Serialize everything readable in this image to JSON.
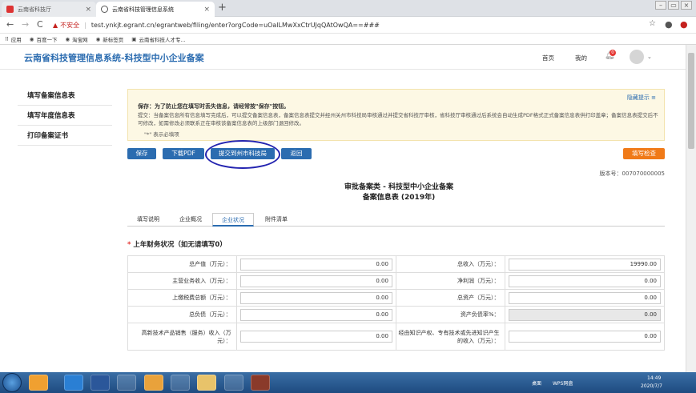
{
  "browser": {
    "tabs": [
      {
        "label": "云南省科技厅",
        "active": false,
        "color": "#d33"
      },
      {
        "label": "云南省科技管理信息系统",
        "active": true,
        "color": "#333"
      }
    ],
    "url_warning": "不安全",
    "url": "test.ynkjt.egrant.cn/egrantweb/filing/enter?orgCode=uOalLMwXxCtrUJqQAtOwQA==###",
    "bookmarks": [
      "应用",
      "百度一下",
      "淘宝网",
      "新标签页",
      "云南省科技人才专..."
    ]
  },
  "app": {
    "title": "云南省科技管理信息系统-科技型中小企业备案",
    "nav_home": "首页",
    "nav_mine": "我的",
    "notif_count": "0"
  },
  "sidebar": {
    "items": [
      "填写备案信息表",
      "填写年度信息表",
      "打印备案证书"
    ]
  },
  "notice": {
    "hide_label": "隐藏提示 ≡",
    "line1": "保存：为了防止您在填写时丢失信息，请经常按\"保存\"按钮。",
    "line2": "提交：当备案信息所有信息填写完成后，可以提交备案信息表，备案信息表提交并经州关州市科技局审核通过并提交省科技厅审核，省科技厅审核通过后系统会自动生成PDF格式正式备案信息表供打印盖章；备案信息表提交后不可修改，如需修改必须联系正在审核该备案信息表的上级部门退回修改。",
    "line3": "\"*\" 表示必填项"
  },
  "actions": {
    "save": "保存",
    "download": "下载PDF",
    "submit": "提交到州市科技局",
    "back": "返回",
    "check": "填写检查"
  },
  "version": "版本号：007070000005",
  "form": {
    "title1": "审批备案类 - 科技型中小企业备案",
    "title2": "备案信息表 (2019年)",
    "tabs": [
      "填写说明",
      "企业概况",
      "企业状况",
      "附件清单"
    ],
    "active_tab": 2,
    "section_title": "上年财务状况（如无请填写0）",
    "section_req": "*"
  },
  "finance": {
    "rows": [
      {
        "l1": "总产值（万元）：",
        "v1": "0.00",
        "l2": "总收入（万元）：",
        "v2": "19990.00",
        "ro2": false
      },
      {
        "l1": "主营业务收入（万元）：",
        "v1": "0.00",
        "l2": "净利润（万元）：",
        "v2": "0.00",
        "ro2": false
      },
      {
        "l1": "上缴税费总额（万元）：",
        "v1": "0.00",
        "l2": "总资产（万元）：",
        "v2": "0.00",
        "ro2": false
      },
      {
        "l1": "总负债（万元）：",
        "v1": "0.00",
        "l2": "资产负债率%：",
        "v2": "0.00",
        "ro2": true
      },
      {
        "l1": "高新技术产品销售（服务）收入（万元）：",
        "v1": "0.00",
        "l2": "经由知识产权、专有技术或先进知识产生的收入（万元）：",
        "v2": "0.00",
        "ro2": false
      }
    ]
  },
  "taskbar": {
    "tray_text": "WPS网盘",
    "time": "14:49",
    "date": "2020/7/7",
    "tray_label": "桌面"
  }
}
